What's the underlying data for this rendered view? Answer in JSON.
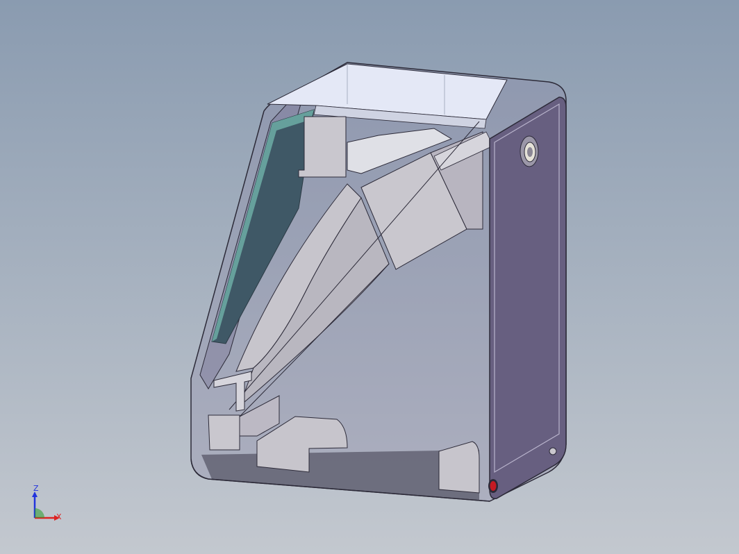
{
  "viewport": {
    "background_top": "#8a9bb0",
    "background_bottom": "#c3c8cf"
  },
  "model": {
    "body_color": "#6b6384",
    "panel_color": "#675f80",
    "glass_color": "#3f5866",
    "glass_edge_color": "#6aa9a2",
    "part_color": "#c7c5cc",
    "top_color": "#e4e8f6",
    "indicator_color": "#c61a22"
  },
  "triad": {
    "z_label": "Z",
    "x_label": "X",
    "z_color": "#2233dd",
    "x_color": "#dd2222",
    "y_color": "#2a9a2a"
  }
}
